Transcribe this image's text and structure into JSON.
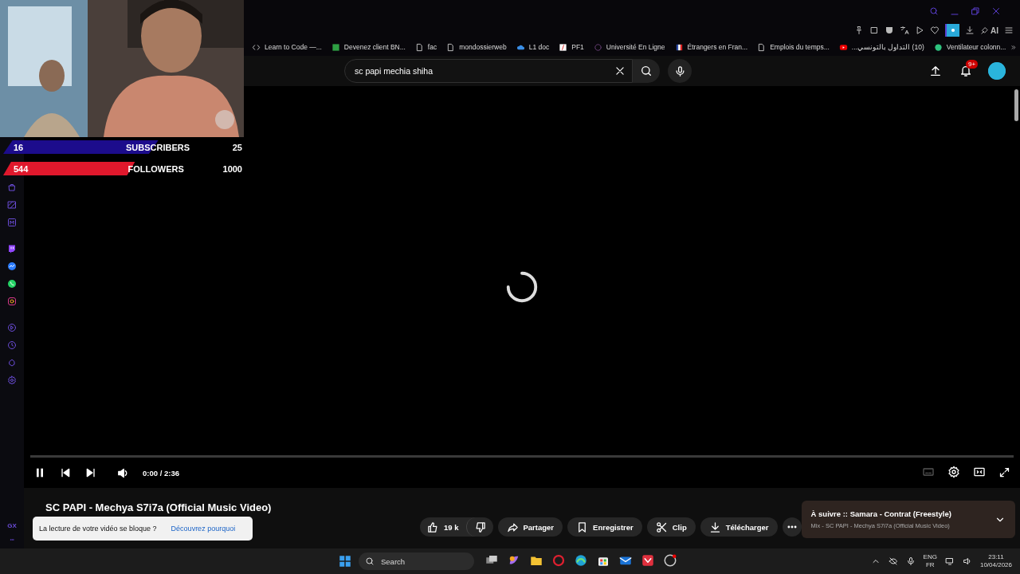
{
  "overlay": {
    "counters": [
      {
        "value": "16",
        "label": "SUBSCRIBERS",
        "goal": "25",
        "level": 0.64,
        "color": "#1c0c8c"
      },
      {
        "value": "544",
        "label": "FOLLOWERS",
        "goal": "1000",
        "level": 0.544,
        "color": "#e0182c"
      }
    ]
  },
  "browser": {
    "ai_label": "AI",
    "bookmarks": [
      {
        "label": "Learn to Code —..."
      },
      {
        "label": "Devenez client BN..."
      },
      {
        "label": "fac"
      },
      {
        "label": "mondossierweb"
      },
      {
        "label": "L1 doc"
      },
      {
        "label": "PF1"
      },
      {
        "label": "Université En Ligne"
      },
      {
        "label": "Étrangers en Fran..."
      },
      {
        "label": "Emplois du temps..."
      },
      {
        "label": "(10) التداول بالتونسي..."
      },
      {
        "label": "Ventilateur colonn..."
      }
    ]
  },
  "header": {
    "search_value": "sc papi mechia shiha",
    "notification_badge": "9+"
  },
  "player": {
    "playing": true,
    "time": "0:00 / 2:36"
  },
  "video": {
    "title": "SC PAPI - Mechya S7i7a (Official Music Video)",
    "notice": {
      "text": "La lecture de votre vidéo se bloque ?",
      "link": "Découvrez pourquoi"
    },
    "like_count": "19 k",
    "actions": [
      {
        "label": "Partager"
      },
      {
        "label": "Enregistrer"
      },
      {
        "label": "Clip"
      },
      {
        "label": "Télécharger"
      }
    ],
    "up_next": {
      "title": "À suivre :: Samara - Contrat (Freestyle)",
      "subtitle": "Mix - SC PAPI - Mechya S7i7a (Official Music Video)"
    }
  },
  "sidebar": {
    "footer_label": "GX"
  },
  "taskbar": {
    "search_placeholder": "Search",
    "language": "ENG",
    "layout": "FR",
    "time": "23:11",
    "date": "10/04/2026"
  }
}
